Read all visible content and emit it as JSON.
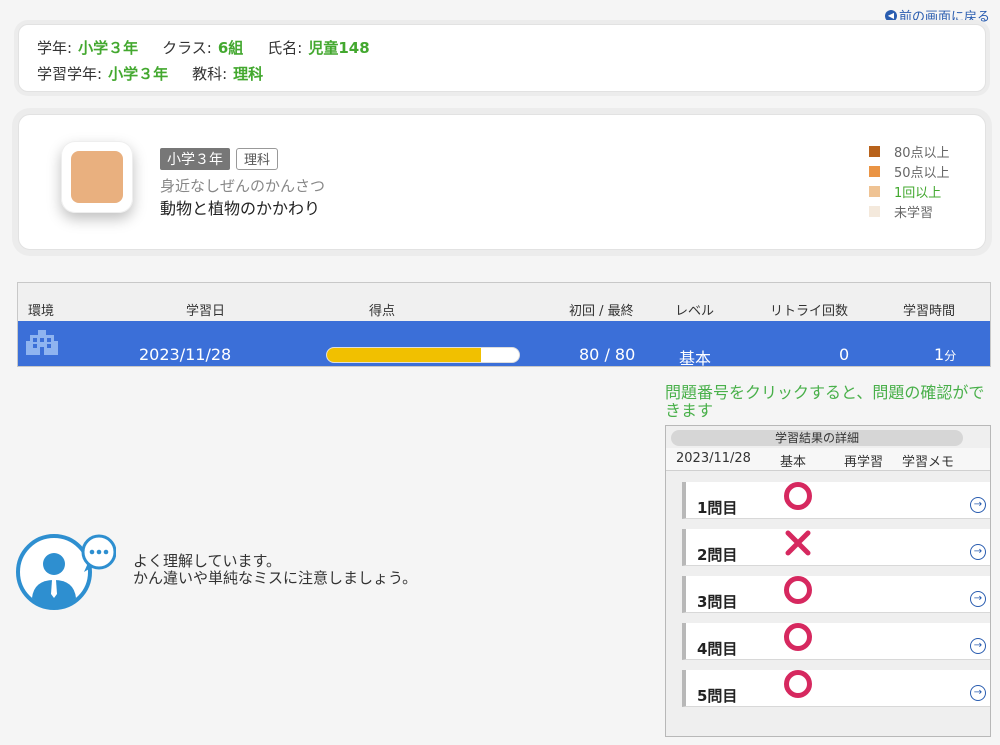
{
  "nav": {
    "back_label": "前の画面に戻る",
    "back_icon": "left-arrow-circle-icon"
  },
  "student": {
    "grade_label": "学年:",
    "grade": "小学３年",
    "class_label": "クラス:",
    "class": "6組",
    "name_label": "氏名:",
    "name": "児童148",
    "study_grade_label": "学習学年:",
    "study_grade": "小学３年",
    "subject_label": "教科:",
    "subject": "理科"
  },
  "unit": {
    "grade_tag": "小学３年",
    "subject_tag": "理科",
    "subtitle": "身近なしぜんのかんさつ",
    "title": "動物と植物のかかわり",
    "icon_color": "#e9b07f",
    "legend": [
      {
        "label": "80点以上",
        "color": "#b8621b",
        "text_color": "#666"
      },
      {
        "label": "50点以上",
        "color": "#ea9444",
        "text_color": "#666"
      },
      {
        "label": "1回以上",
        "color": "#efc394",
        "text_color": "#43a82f"
      },
      {
        "label": "未学習",
        "color": "#f4e9dc",
        "text_color": "#666"
      }
    ]
  },
  "results": {
    "headers": {
      "env": "環境",
      "date": "学習日",
      "score": "得点",
      "first_last": "初回 / 最終",
      "level": "レベル",
      "retry": "リトライ回数",
      "time": "学習時間"
    },
    "row": {
      "env_icon": "school-building-icon",
      "date": "2023/11/28",
      "score_fraction": 0.8,
      "first_last": "80 / 80",
      "level": "基本",
      "retry": "0",
      "time": "1",
      "time_unit": "分"
    },
    "row_color": "#3b6fd8",
    "bar_color": "#f1c000"
  },
  "hint": "問題番号をクリックすると、問題の確認ができます",
  "detail": {
    "title": "学習結果の詳細",
    "headers": {
      "date": "2023/11/28",
      "level": "基本",
      "relearn": "再学習",
      "memo": "学習メモ"
    },
    "items": [
      {
        "label": "1問目",
        "result": "correct"
      },
      {
        "label": "2問目",
        "result": "incorrect"
      },
      {
        "label": "3問目",
        "result": "correct"
      },
      {
        "label": "4問目",
        "result": "correct"
      },
      {
        "label": "5問目",
        "result": "correct"
      }
    ],
    "mark_color": "#d6285f"
  },
  "advice": {
    "icon": "advisor-speech-icon",
    "line1": "よく理解しています。",
    "line2": "かん違いや単純なミスに注意しましょう。"
  }
}
